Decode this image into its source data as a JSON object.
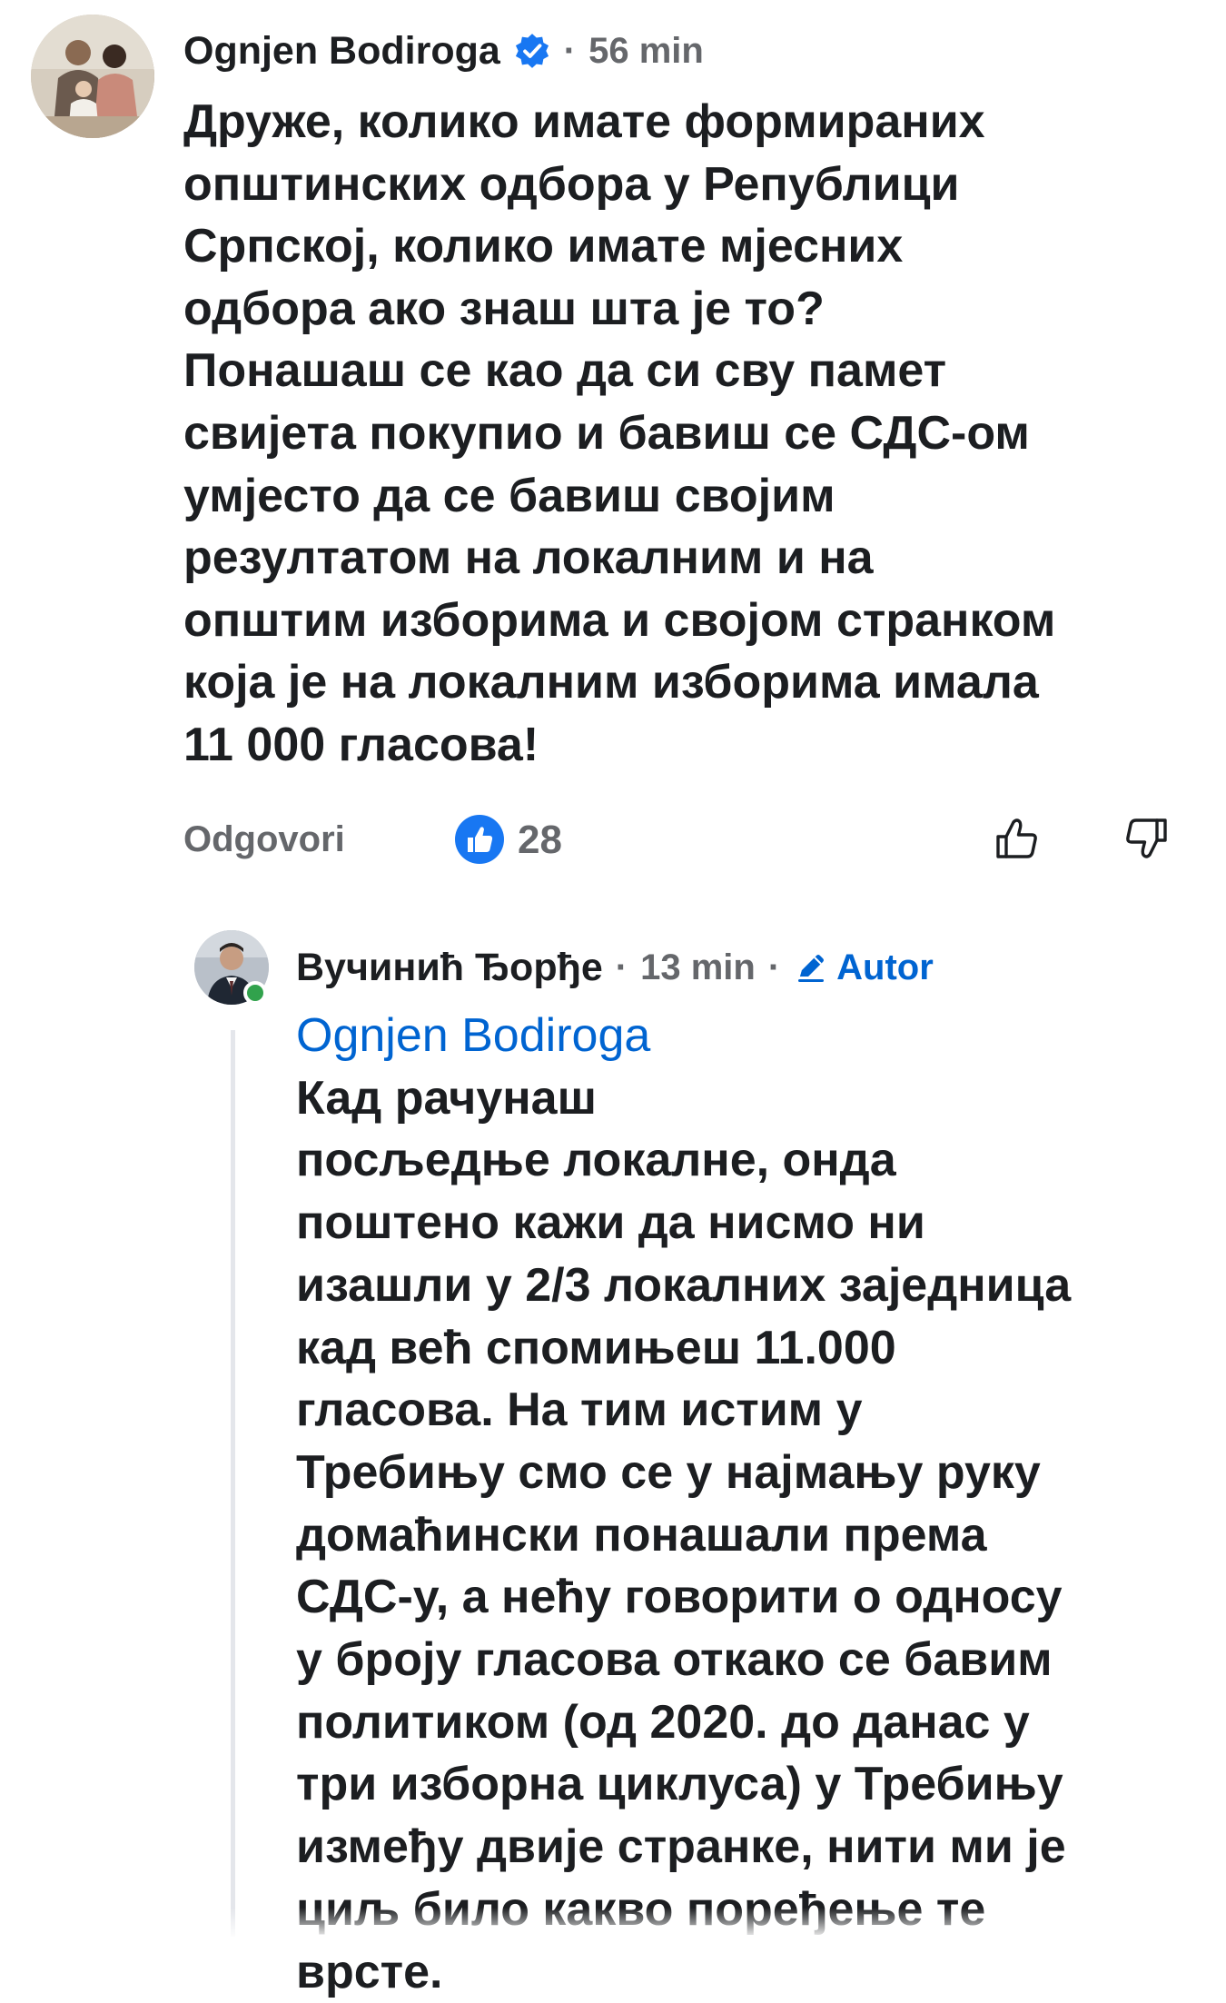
{
  "comment": {
    "author": "Ognjen Bodiroga",
    "verified": true,
    "time": "56 min",
    "lines": [
      "Друже, колико имате формираних",
      "општинских одбора у Републици",
      "Српској, колико имате мјесних",
      "одбора ако знаш шта је то?",
      "Понашаш се као да си сву памет",
      "свијета покупио и бавиш се СДС-ом",
      "умјесто да се бавиш својим",
      "резултатом на локалним и на",
      "општим изборима и својом странком",
      "која је на локалним изборима имала",
      "11 000 гласова!"
    ],
    "actions": {
      "reply_label": "Odgovori",
      "like_count": "28"
    },
    "icons": {
      "verified": "verified-badge-icon",
      "like": "like-reaction-icon",
      "upvote": "thumbs-up-icon",
      "downvote": "thumbs-down-icon"
    }
  },
  "reply": {
    "author": "Вучинић Ђорђе",
    "time": "13 min",
    "author_tag": "Autor",
    "mention": "Ognjen Bodiroga",
    "first_line_rest": "Кад рачунаш",
    "lines": [
      "посљедње локалне, онда",
      "поштено кажи да нисмо ни",
      "изашли у 2/3 локалних заједница",
      "кад већ спомињеш 11.000",
      "гласова. На тим истим у",
      "Требињу смо се у најмању руку",
      "домаћински понашали према",
      "СДС-у, а нећу говорити о односу",
      "у броју гласова откако се бавим",
      "политиком (од 2020. до данас у",
      "три изборна циклуса) у Требињу",
      "између двије странке, нити ми је",
      "циљ било какво поређење те",
      "врсте."
    ],
    "icons": {
      "author_tag": "pencil-icon",
      "online": "online-status-icon"
    }
  },
  "meta_separator": "·",
  "colors": {
    "text": "#1c1e21",
    "secondary": "#65676b",
    "link": "#0064d1",
    "like_blue": "#1877f2",
    "online": "#31a24c"
  }
}
